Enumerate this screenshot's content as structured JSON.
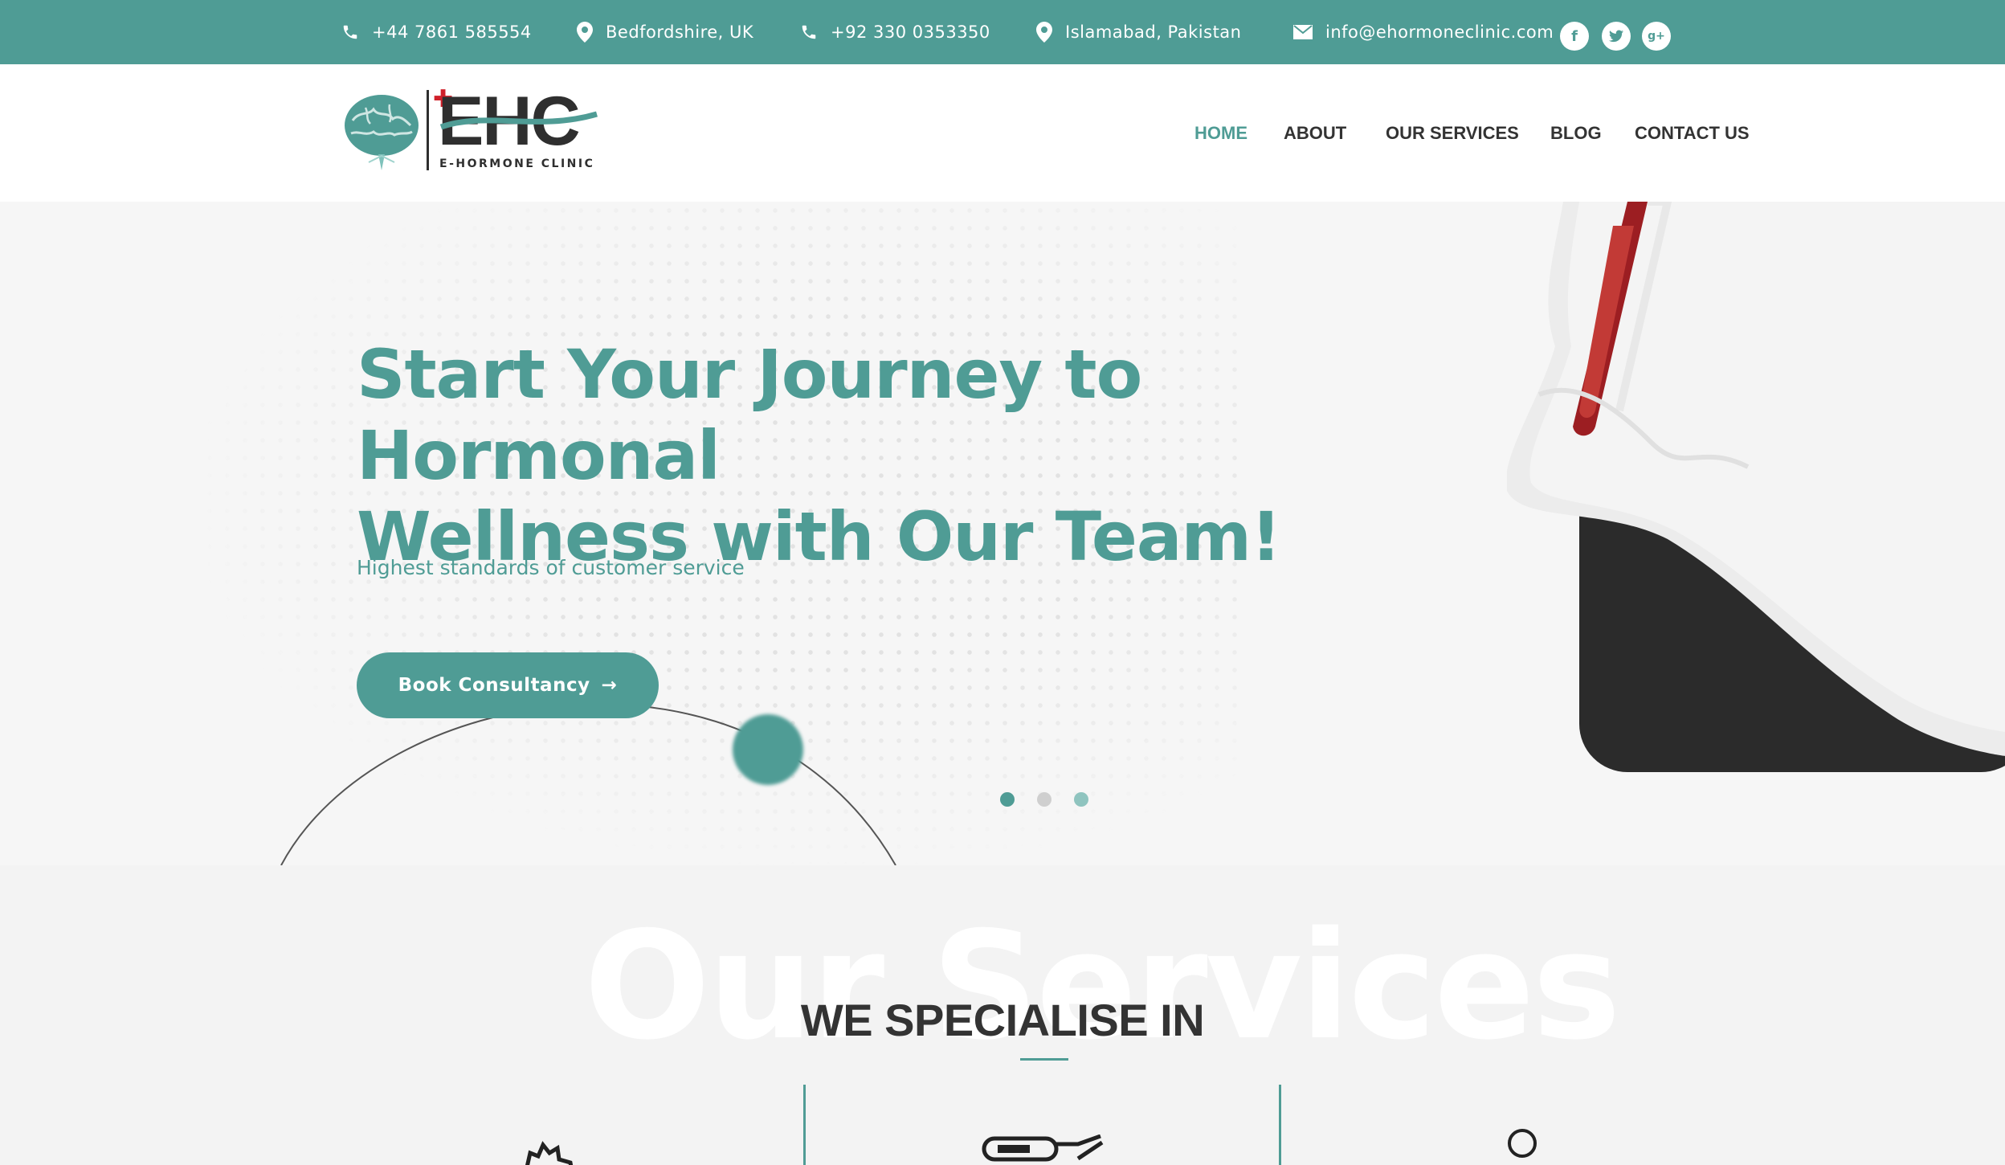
{
  "topbar": {
    "phone_uk": "+44 7861 585554",
    "location_uk": "Bedfordshire, UK",
    "phone_pk": "+92 330 0353350",
    "location_pk": "Islamabad, Pakistan",
    "email": "info@ehormoneclinic.com",
    "social": {
      "facebook": "f",
      "twitter": "t",
      "google_plus": "g+"
    }
  },
  "brand": {
    "logo_text": "EHC",
    "logo_sub": "E-HORMONE CLINIC"
  },
  "nav": {
    "home": "HOME",
    "about": "ABOUT",
    "services": "OUR SERVICES",
    "blog": "BLOG",
    "contact": "CONTACT US"
  },
  "hero": {
    "title_line1": "Start Your Journey to Hormonal",
    "title_line2": "Wellness with Our Team!",
    "subtitle": "Highest standards of customer service",
    "cta_label": "Book Consultancy",
    "cta_arrow": "→",
    "slide_count": 3,
    "active_slide": 1
  },
  "services": {
    "background_word": "Our Services",
    "heading": "WE SPECIALISE IN"
  },
  "colors": {
    "accent": "#4f9c95",
    "dark": "#333333",
    "hero_bg": "#f6f6f6"
  },
  "icons": [
    "phone-icon",
    "location-pin-icon",
    "mail-icon",
    "facebook-icon",
    "twitter-icon",
    "google-plus-icon",
    "brain-icon",
    "arrow-right-icon",
    "gear-icon",
    "thermometer-icon",
    "stethoscope-icon"
  ]
}
